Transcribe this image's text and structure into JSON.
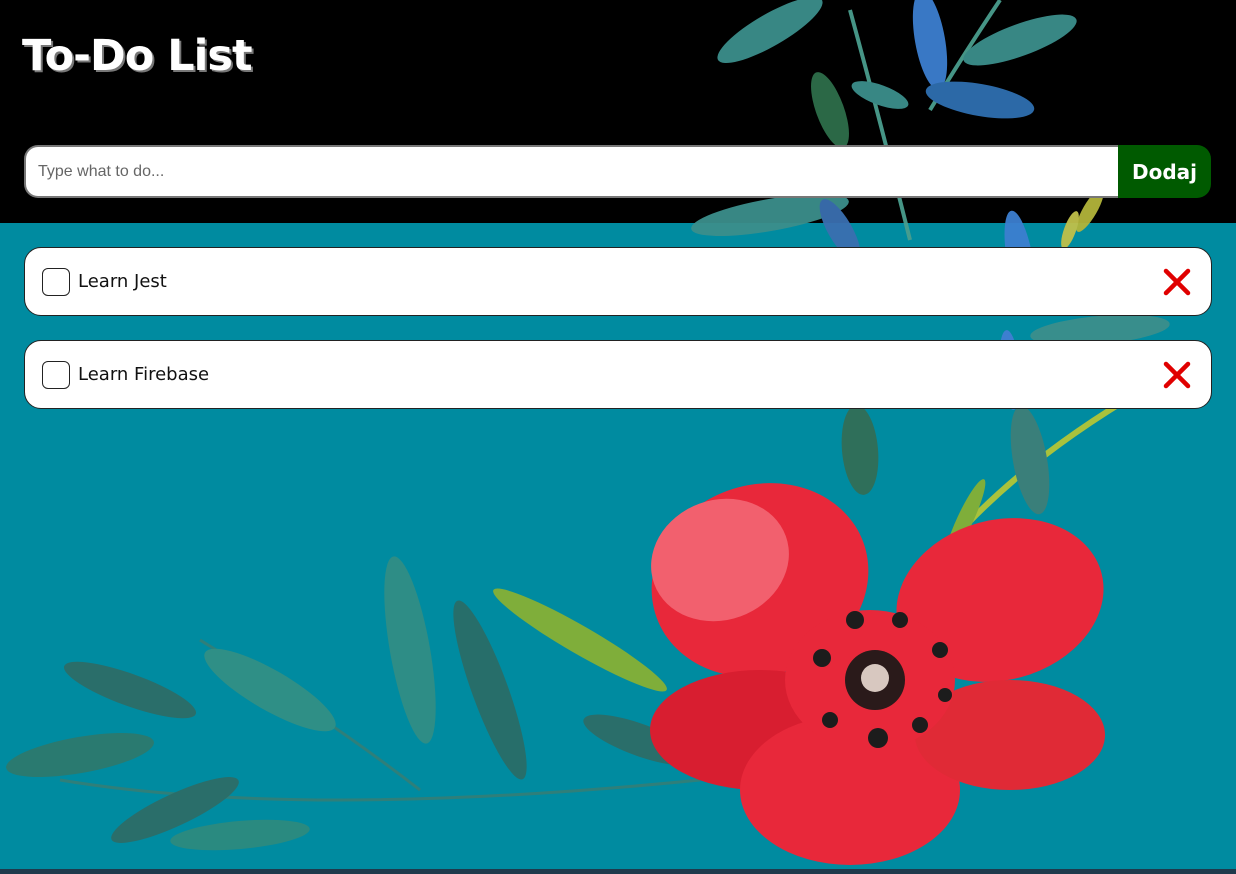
{
  "header": {
    "title": "To-Do List"
  },
  "form": {
    "placeholder": "Type what to do...",
    "add_label": "Dodaj"
  },
  "todos": [
    {
      "text": "Learn Jest",
      "done": false
    },
    {
      "text": "Learn Firebase",
      "done": false
    }
  ],
  "icons": {
    "checkbox": "checkbox-empty-icon",
    "delete": "close-x-icon",
    "decoration": "floral-painting"
  },
  "colors": {
    "header_bg": "#000000",
    "page_bg": "#008ba0",
    "add_button": "#005a00",
    "delete_icon": "#e00000",
    "flower": "#e8283a"
  }
}
